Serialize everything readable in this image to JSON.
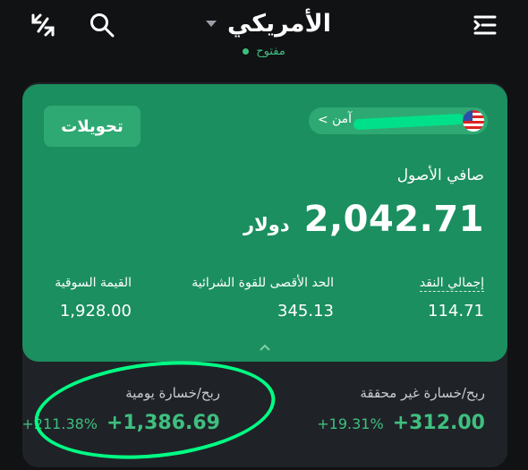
{
  "header": {
    "title": "الأمريكي",
    "status": "مفتوح",
    "icons": {
      "left1": "hamburger-menu-icon",
      "left2": "swap-icon",
      "search": "search-icon"
    }
  },
  "account": {
    "transfer_label": "تحويلات",
    "pill_text": "آمن",
    "flag": "us-flag"
  },
  "summary": {
    "net_label": "صافي الأصول",
    "net_value": "2,042.71",
    "net_unit": "دولار"
  },
  "metrics": [
    {
      "label": "إجمالي النقد",
      "value": "114.71"
    },
    {
      "label": "الحد الأقصى للقوة الشرائية",
      "value": "345.13"
    },
    {
      "label": "القيمة السوقية",
      "value": "1,928.00"
    }
  ],
  "pnl": {
    "unrealized": {
      "label": "ربح/خسارة غير محققة",
      "amount": "+312.00",
      "percent": "+19.31%"
    },
    "daily": {
      "label": "ربح/خسارة يومية",
      "amount": "+1,386.69",
      "percent": "+211.38%"
    }
  },
  "colors": {
    "card": "#1b8f5f",
    "accent": "#3fbf7f",
    "annotation": "#00ff84"
  }
}
